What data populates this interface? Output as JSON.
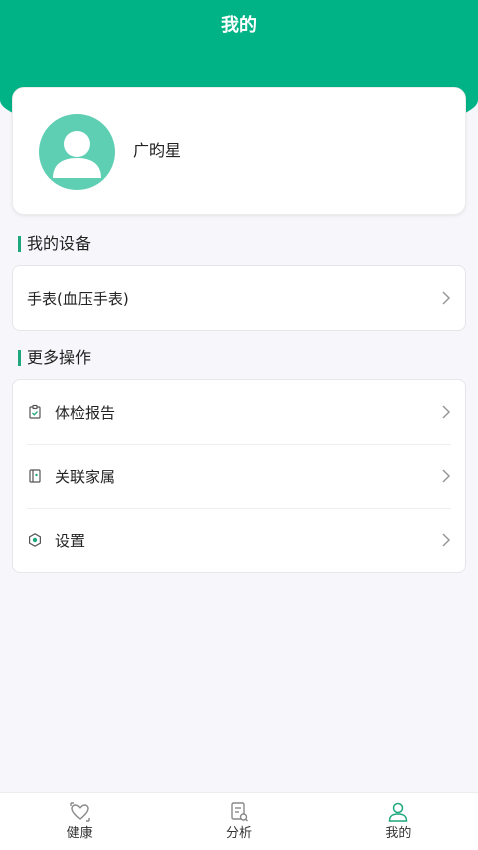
{
  "header": {
    "title": "我的"
  },
  "profile": {
    "name": "广昀星"
  },
  "devices": {
    "section_title": "我的设备",
    "items": [
      {
        "label": "手表(血压手表)"
      }
    ]
  },
  "more": {
    "section_title": "更多操作",
    "items": [
      {
        "label": "体检报告",
        "icon": "clipboard-check-icon"
      },
      {
        "label": "关联家属",
        "icon": "contact-book-icon"
      },
      {
        "label": "设置",
        "icon": "settings-gear-icon"
      }
    ]
  },
  "tabbar": {
    "items": [
      {
        "label": "健康",
        "icon": "health-heart-icon"
      },
      {
        "label": "分析",
        "icon": "analysis-report-icon"
      },
      {
        "label": "我的",
        "icon": "user-profile-icon",
        "active": true
      }
    ]
  },
  "colors": {
    "brand": "#00b386",
    "accent": "#1ea77c",
    "avatar_bg": "#5fcfb4",
    "background": "#f7f6fa"
  }
}
